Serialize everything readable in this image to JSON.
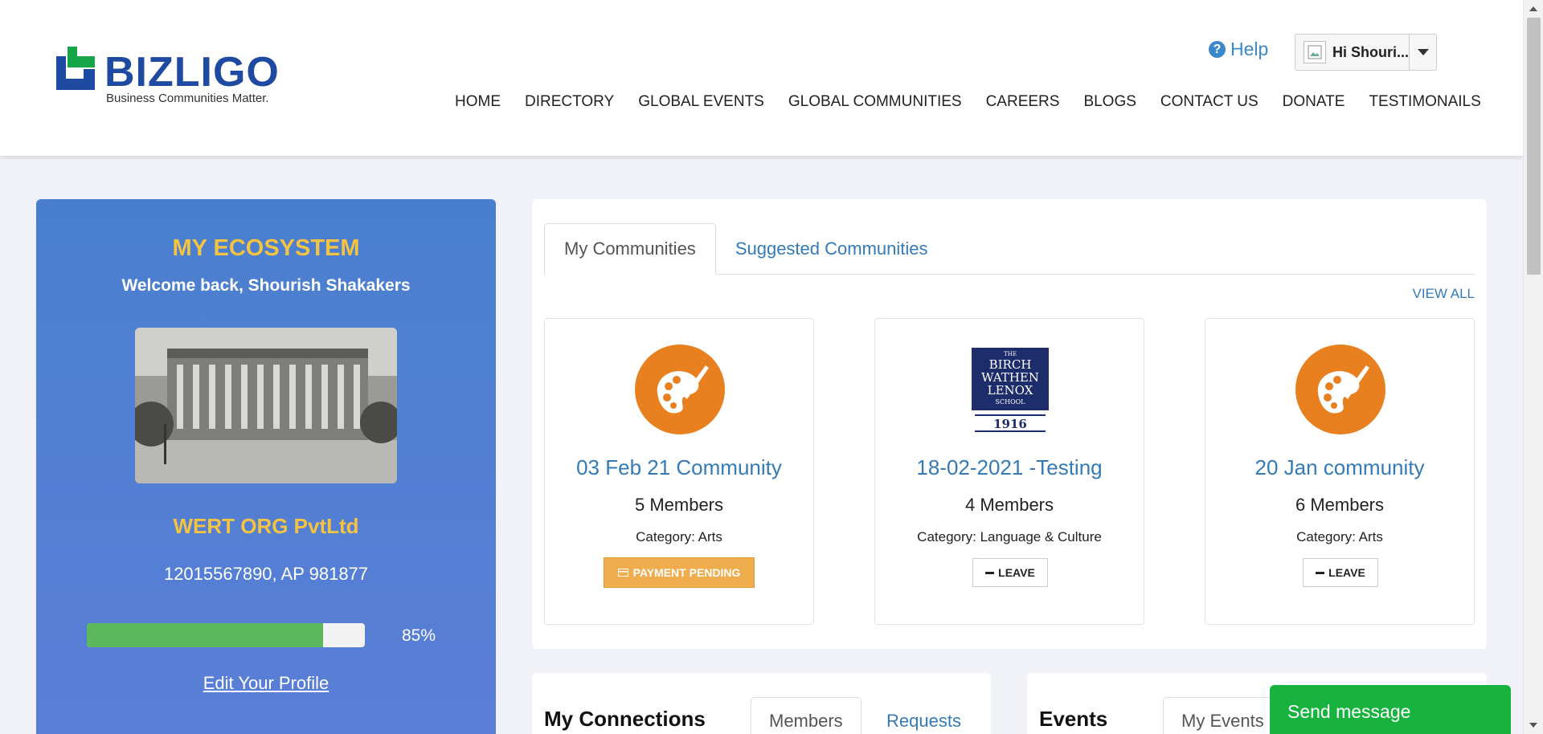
{
  "header": {
    "logo_text": "BIZLIGO",
    "logo_tagline": "Business Communities Matter.",
    "help_label": "Help",
    "user_greeting": "Hi Shouri...",
    "nav": [
      "HOME",
      "DIRECTORY",
      "GLOBAL EVENTS",
      "GLOBAL COMMUNITIES",
      "CAREERS",
      "BLOGS",
      "CONTACT US",
      "DONATE",
      "TESTIMONAILS"
    ]
  },
  "ecosystem": {
    "title": "MY ECOSYSTEM",
    "welcome": "Welcome back, Shourish Shakakers",
    "org_name": "WERT ORG PvtLtd",
    "phone_line": "12015567890, AP 981877",
    "profile_completion": 0.85,
    "profile_completion_label": "85%",
    "edit_profile": "Edit Your Profile"
  },
  "communities": {
    "tabs": [
      "My Communities",
      "Suggested Communities"
    ],
    "active_tab": "My Communities",
    "view_all": "VIEW ALL",
    "cards": [
      {
        "name": "03 Feb 21 Community",
        "members": "5 Members",
        "category": "Category: Arts",
        "action": "PAYMENT PENDING",
        "logo": "palette-icon"
      },
      {
        "name": "18-02-2021 -Testing",
        "members": "4 Members",
        "category": "Category: Language & Culture",
        "action": "LEAVE",
        "logo": "school-crest",
        "crest_text": [
          "THE",
          "BIRCH",
          "WATHEN",
          "LENOX",
          "SCHOOL",
          "1916"
        ]
      },
      {
        "name": "20 Jan community",
        "members": "6 Members",
        "category": "Category: Arts",
        "action": "LEAVE",
        "logo": "palette-icon"
      }
    ]
  },
  "connections": {
    "title": "My Connections",
    "tabs": [
      "Members",
      "Requests"
    ]
  },
  "events": {
    "title": "Events",
    "tabs": [
      "My Events"
    ]
  },
  "chat": {
    "send_message": "Send message"
  },
  "colors": {
    "brand_blue": "#1f4aa1",
    "brand_green": "#17a54a",
    "accent_yellow": "#f5c342",
    "link_blue": "#337ab7",
    "palette_orange": "#e8801f",
    "pending_orange": "#f0ad4e",
    "chat_green": "#17b33e"
  }
}
